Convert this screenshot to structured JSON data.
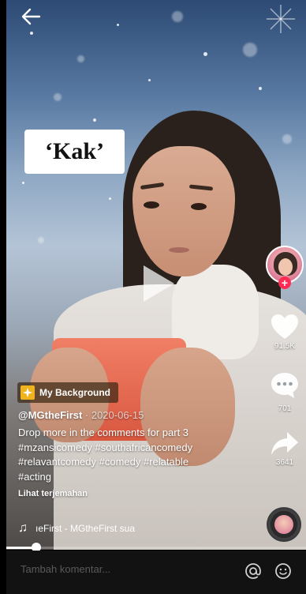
{
  "video": {
    "caption_sticker": "‘Kak’"
  },
  "rail": {
    "likes": "91.5K",
    "comments": "701",
    "shares": "3641",
    "follow_symbol": "+"
  },
  "badge": {
    "label": "My Background"
  },
  "post": {
    "username": "@MGtheFirst",
    "date": " · 2020-06-15",
    "description_lines": [
      "Drop more in the comments for part 3",
      "#mzansicomedy #southafricancomedy",
      "#relavantcomedy #comedy #relatable",
      "#acting"
    ],
    "translate": "Lihat terjemahan"
  },
  "music": {
    "note": "♫",
    "text": "ıeFirst - MGtheFirst   sua"
  },
  "progress": {
    "fraction": 0.1
  },
  "comment": {
    "placeholder": "Tambah komentar..."
  },
  "colors": {
    "accent": "#fe2c55",
    "comment_bar": "#121212",
    "badge_icon": "#f0b320"
  },
  "icons": [
    "back-arrow-icon",
    "play-icon",
    "heart-icon",
    "comment-icon",
    "share-icon",
    "music-note-icon",
    "at-icon",
    "emoji-icon"
  ]
}
